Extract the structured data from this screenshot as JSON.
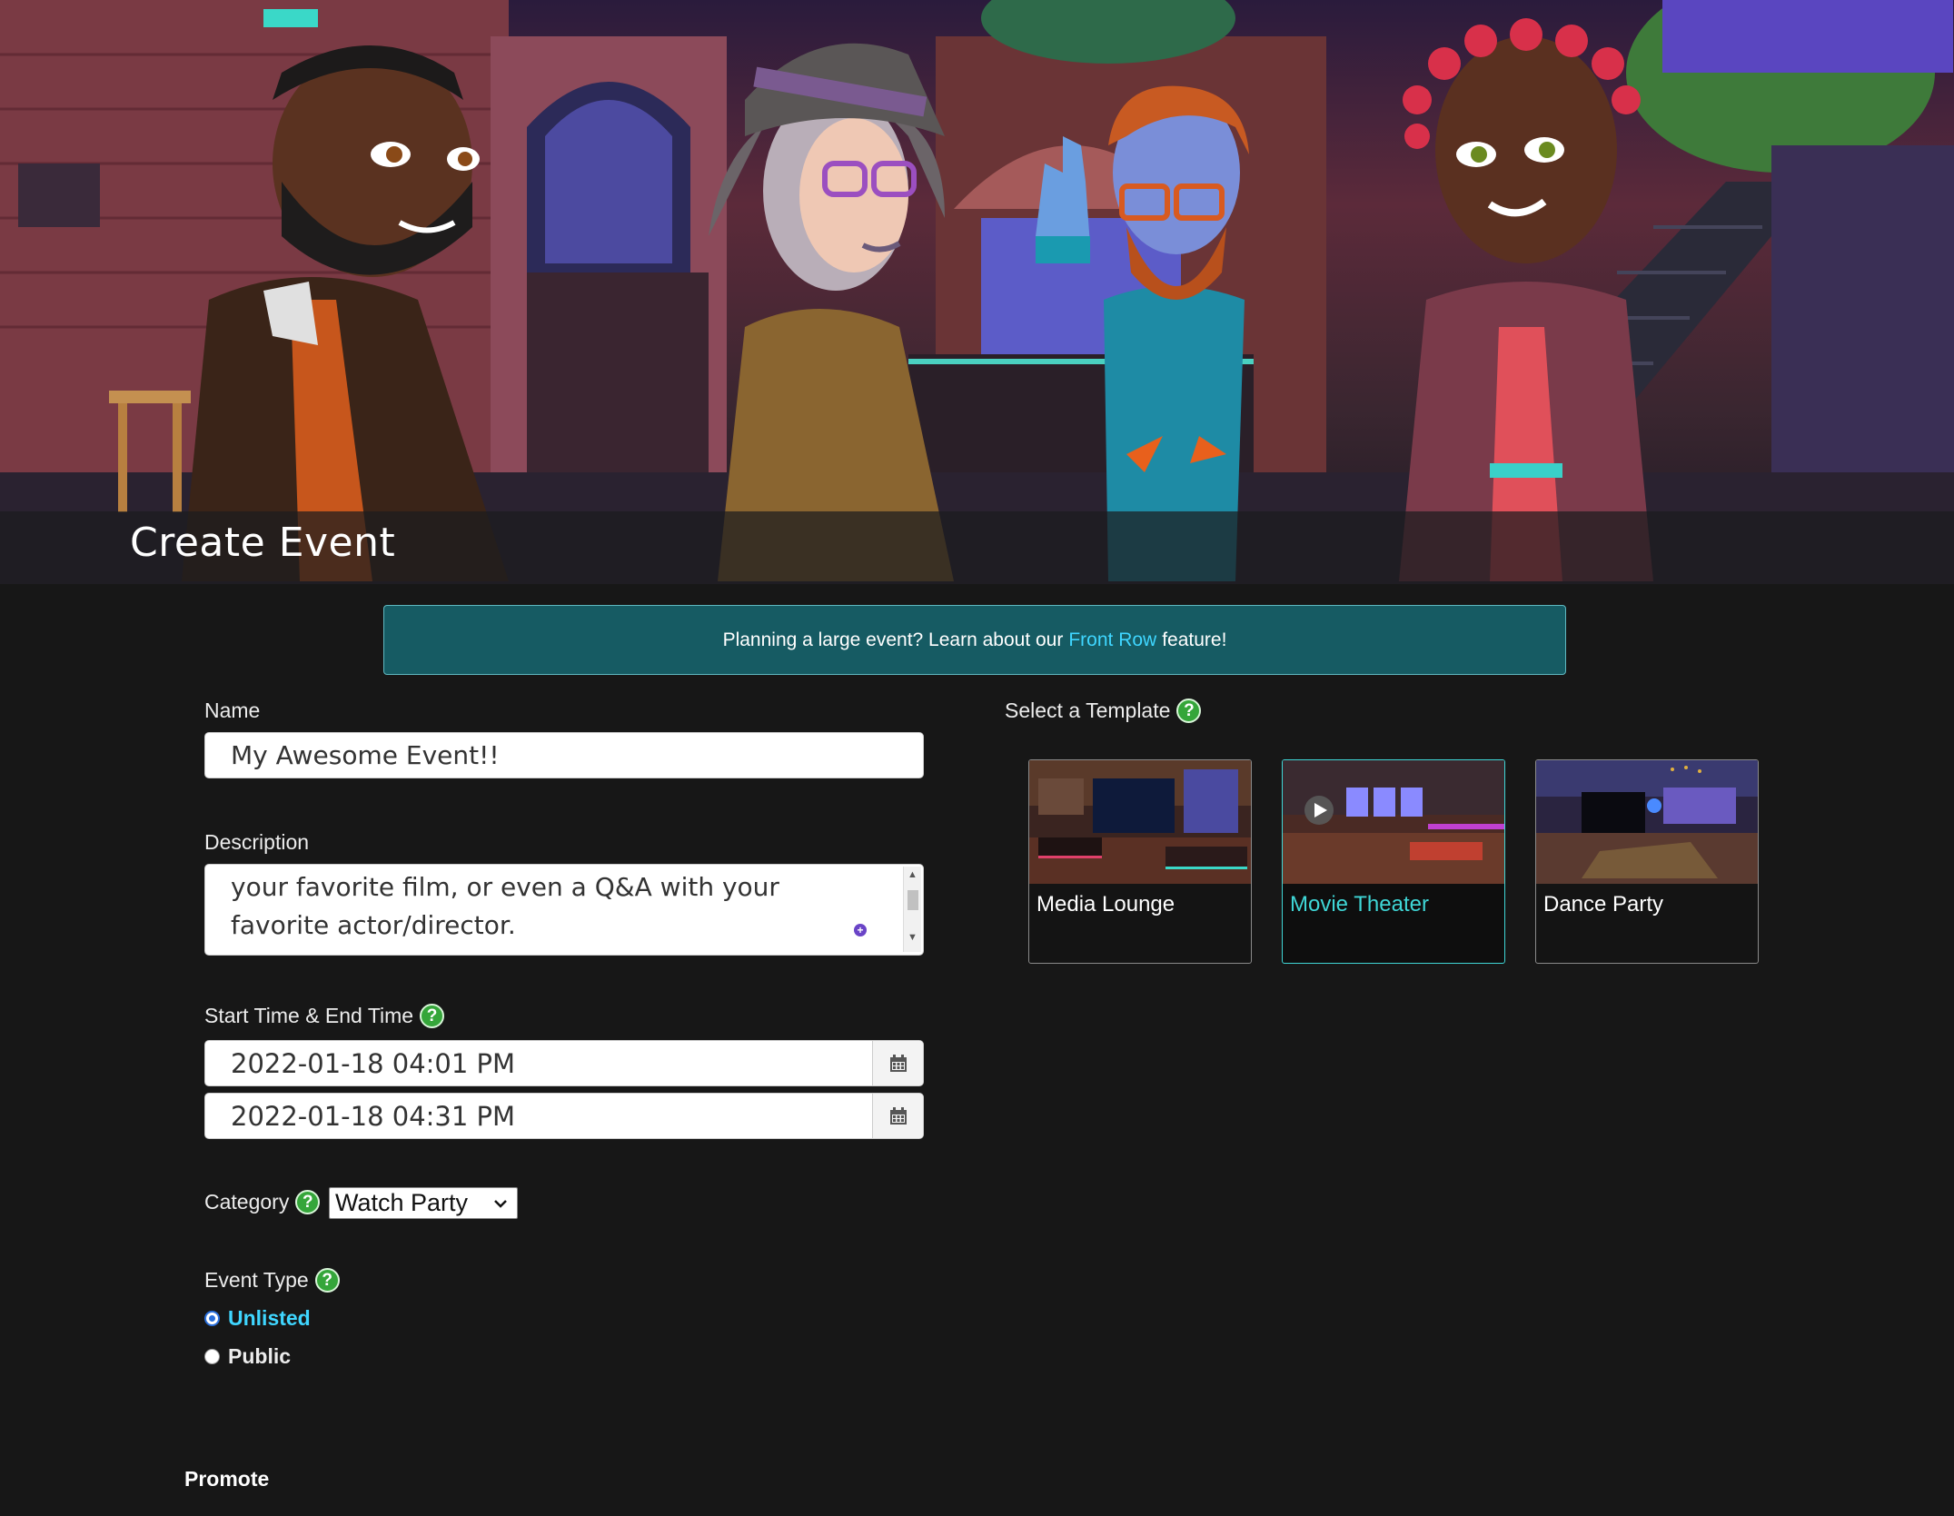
{
  "hero": {
    "title": "Create Event"
  },
  "banner": {
    "text_before": "Planning a large event? Learn about our",
    "link": "Front Row",
    "text_after": "feature!"
  },
  "form": {
    "name_label": "Name",
    "name_value": "My Awesome Event!!",
    "description_label": "Description",
    "description_lines": [
      "your favorite film, or even a Q&A with your",
      "favorite actor/director."
    ],
    "time_label": "Start Time & End Time",
    "start_time": "2022-01-18 04:01 PM",
    "end_time": "2022-01-18 04:31 PM",
    "category_label": "Category",
    "category_value": "Watch Party",
    "event_type_label": "Event Type",
    "event_types": [
      {
        "label": "Unlisted",
        "selected": true
      },
      {
        "label": "Public",
        "selected": false
      }
    ],
    "promote_label": "Promote",
    "help_glyph": "?"
  },
  "templates": {
    "label": "Select a Template",
    "items": [
      {
        "label": "Media Lounge",
        "selected": false
      },
      {
        "label": "Movie Theater",
        "selected": true
      },
      {
        "label": "Dance Party",
        "selected": false
      }
    ]
  },
  "colors": {
    "background": "#171717",
    "banner": "#165b63",
    "link": "#3fd6ff",
    "selected_accent": "#3fd6d6",
    "help_badge": "#35a63a",
    "radio_selected_text": "#3fd6ff"
  },
  "icons": [
    "help-icon",
    "calendar-icon",
    "chevron-down-icon",
    "play-icon"
  ]
}
